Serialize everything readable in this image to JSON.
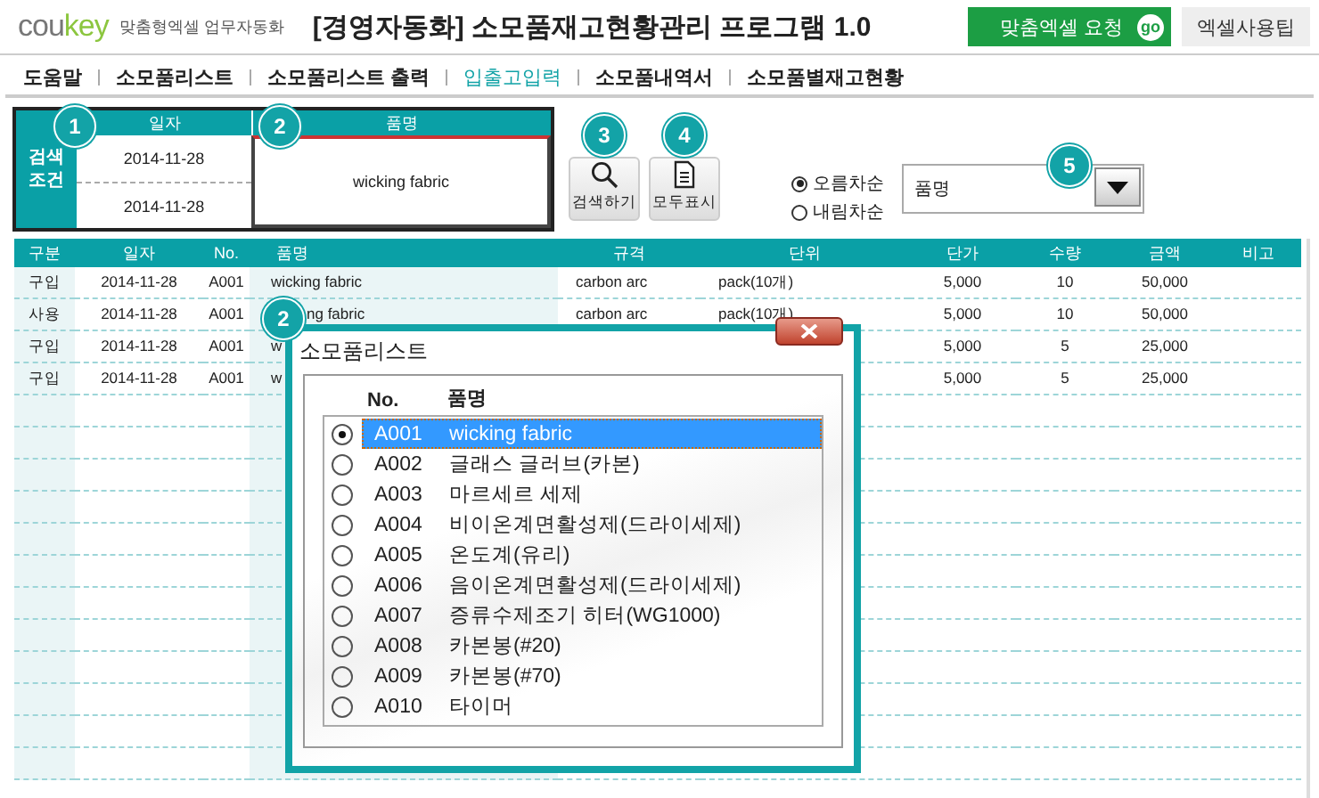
{
  "header": {
    "logo_left": "cou",
    "logo_right": "key",
    "tagline": "맞춤형엑셀 업무자동화",
    "title": "[경영자동화] 소모품재고현황관리 프로그램 1.0",
    "buttons": [
      {
        "label": "맞춤엑셀 요청",
        "badge": "go",
        "kind": "primary"
      },
      {
        "label": "엑셀사용팁",
        "kind": "secondary"
      }
    ]
  },
  "menu": [
    {
      "label": "도움말",
      "selected": false
    },
    {
      "label": "소모품리스트",
      "selected": false
    },
    {
      "label": "소모품리스트 출력",
      "selected": false
    },
    {
      "label": "입출고입력",
      "selected": true
    },
    {
      "label": "소모품내역서",
      "selected": false
    },
    {
      "label": "소모품별재고현황",
      "selected": false
    }
  ],
  "search": {
    "label": "검색조건",
    "date_header": "일자",
    "date_marker": "1",
    "dates": [
      "2014-11-28",
      "2014-11-28"
    ],
    "item_header": "품명",
    "item_marker": "2",
    "item_value": "wicking fabric"
  },
  "actions": [
    {
      "label": "검색하기",
      "marker": "3",
      "kind": "search"
    },
    {
      "label": "모두표시",
      "marker": "4",
      "kind": "document"
    }
  ],
  "sort": {
    "options": [
      {
        "label": "오름차순",
        "selected": true
      },
      {
        "label": "내림차순",
        "selected": false
      }
    ],
    "field": "품명",
    "marker": "5"
  },
  "table": {
    "columns": [
      "구분",
      "일자",
      "No.",
      "품명",
      "규격",
      "단위",
      "단가",
      "수량",
      "금액",
      "비고"
    ],
    "rows": [
      {
        "type": "구입",
        "date": "2014-11-28",
        "no": "A001",
        "item": "wicking fabric",
        "spec": "carbon arc",
        "unit": "pack(10개)",
        "price": "5,000",
        "qty": "10",
        "amount": "50,000"
      },
      {
        "type": "사용",
        "date": "2014-11-28",
        "no": "A001",
        "item": "ng fabric",
        "spec": "carbon arc",
        "unit": "pack(10개)",
        "price": "5,000",
        "qty": "10",
        "amount": "50,000"
      },
      {
        "type": "구입",
        "date": "2014-11-28",
        "no": "A001",
        "item": "w",
        "price": "5,000",
        "qty": "5",
        "amount": "25,000"
      },
      {
        "type": "구입",
        "date": "2014-11-28",
        "no": "A001",
        "item": "w",
        "price": "5,000",
        "qty": "5",
        "amount": "25,000"
      }
    ]
  },
  "dialog": {
    "marker": "2",
    "title": "소모품리스트",
    "no_header": "No.",
    "name_header": "품명",
    "items": [
      {
        "no": "A001",
        "name": "wicking fabric",
        "selected": true
      },
      {
        "no": "A002",
        "name": "글래스 글러브(카본)",
        "selected": false
      },
      {
        "no": "A003",
        "name": "마르세르 세제",
        "selected": false
      },
      {
        "no": "A004",
        "name": "비이온계면활성제(드라이세제)",
        "selected": false
      },
      {
        "no": "A005",
        "name": "온도계(유리)",
        "selected": false
      },
      {
        "no": "A006",
        "name": "음이온계면활성제(드라이세제)",
        "selected": false
      },
      {
        "no": "A007",
        "name": "증류수제조기 히터(WG1000)",
        "selected": false
      },
      {
        "no": "A008",
        "name": "카본봉(#20)",
        "selected": false
      },
      {
        "no": "A009",
        "name": "카본봉(#70)",
        "selected": false
      },
      {
        "no": "A010",
        "name": "타이머",
        "selected": false
      }
    ]
  }
}
